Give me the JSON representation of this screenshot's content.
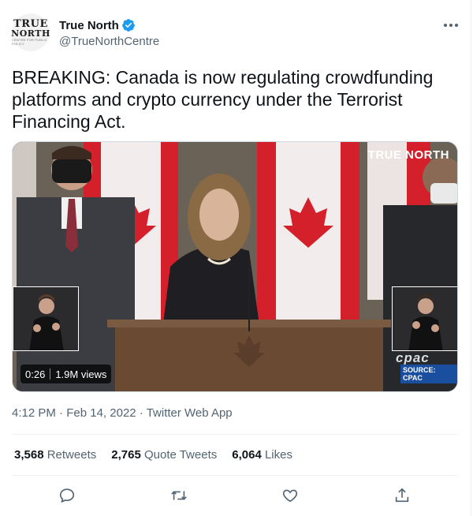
{
  "author": {
    "avatar": {
      "line1": "TRUE",
      "line2": "NORTH",
      "line3": "CENTRE FOR PUBLIC POLICY",
      "icon": "true-north-logo"
    },
    "display_name": "True North",
    "handle": "@TrueNorthCentre",
    "verified_icon": "verified-badge-icon"
  },
  "more_icon": "more-options-icon",
  "tweet": {
    "text": "BREAKING: Canada is now regulating crowdfunding platforms and crypto currency under the Terrorist Financing Act."
  },
  "media": {
    "watermark": "TRUE NORTH",
    "broadcaster": "cpac",
    "source": "SOURCE: CPAC",
    "duration": "0:26",
    "views": "1.9M views"
  },
  "meta": {
    "time": "4:12 PM",
    "date": "Feb 14, 2022",
    "client": "Twitter Web App"
  },
  "stats": {
    "retweets": {
      "count": "3,568",
      "label": "Retweets"
    },
    "quote_tweets": {
      "count": "2,765",
      "label": "Quote Tweets"
    },
    "likes": {
      "count": "6,064",
      "label": "Likes"
    }
  },
  "actions": [
    "reply-icon",
    "retweet-icon",
    "like-icon",
    "share-icon"
  ],
  "colors": {
    "accent": "#1d9bf0",
    "secondary_text": "#536471",
    "border": "#eff3f4"
  }
}
